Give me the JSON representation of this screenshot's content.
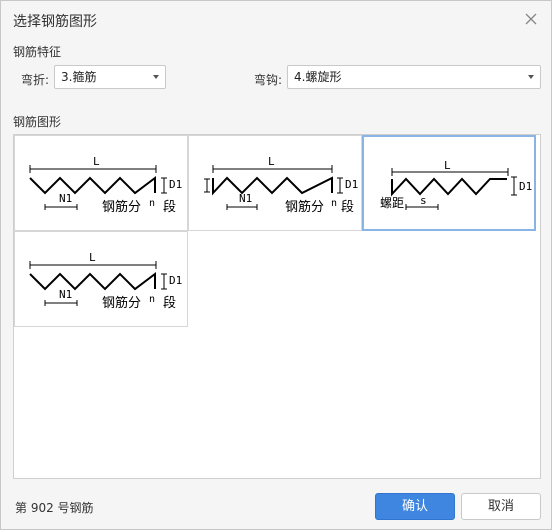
{
  "dialog": {
    "title": "选择钢筋图形",
    "close_glyph": "✕"
  },
  "features": {
    "section_label": "钢筋特征",
    "bend_label": "弯折:",
    "bend_value": "3.箍筋",
    "hook_label": "弯钩:",
    "hook_value": "4.螺旋形"
  },
  "shapes": {
    "section_label": "钢筋图形",
    "items": [
      {
        "L": "L",
        "D1": "D1",
        "N1": "N1",
        "note_prefix": "钢筋分",
        "note_n": "n",
        "note_suffix": "段"
      },
      {
        "L": "L",
        "D1": "D1",
        "N1": "N1",
        "note_prefix": "钢筋分",
        "note_n": "n",
        "note_suffix": "段"
      },
      {
        "L": "L",
        "D1": "D1",
        "pitch_label": "螺距",
        "s": "s"
      },
      {
        "L": "L",
        "D1": "D1",
        "N1": "N1",
        "note_prefix": "钢筋分",
        "note_n": "n",
        "note_suffix": "段"
      }
    ],
    "selected_index": 2
  },
  "footer": {
    "status": "第 902 号钢筋",
    "confirm_label": "确认",
    "cancel_label": "取消"
  },
  "colors": {
    "primary": "#3e86e0",
    "selected_border": "#8ab4e6"
  }
}
